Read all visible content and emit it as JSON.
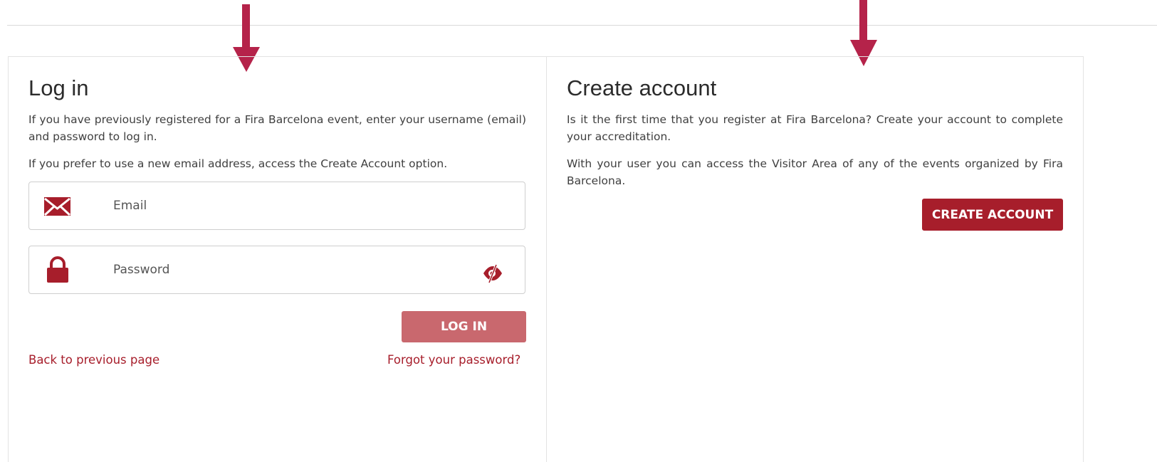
{
  "colors": {
    "brand": "#a71e2b",
    "arrow": "#b5234a",
    "login_button": "#c9686e",
    "text": "#3f3f3f"
  },
  "login": {
    "title": "Log in",
    "intro": "If you have previously registered for a Fira Barcelona event, enter your username (email) and password to log in.",
    "intro2": "If you prefer to use a new email address, access the Create Account option.",
    "email": {
      "icon": "envelope-icon",
      "placeholder": "Email",
      "value": ""
    },
    "password": {
      "icon": "lock-icon",
      "placeholder": "Password",
      "value": "",
      "toggle_icon": "eye-slash-icon"
    },
    "submit_label": "LOG IN",
    "back_link": "Back to previous page",
    "forgot_link": "Forgot your password?"
  },
  "create": {
    "title": "Create account",
    "intro": "Is it the first time that you register at Fira Barcelona? Create your account to complete your accreditation.",
    "intro2": "With your user you can access the Visitor Area of any of the events organized by Fira Barcelona.",
    "button_label": "CREATE ACCOUNT"
  }
}
